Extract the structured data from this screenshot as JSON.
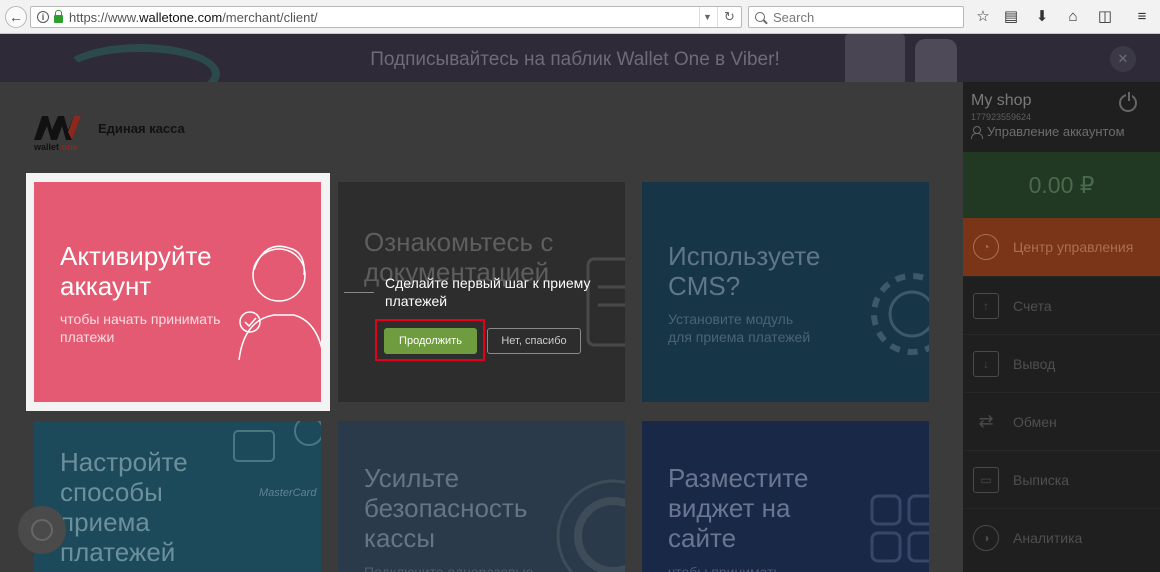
{
  "browser": {
    "url_prefix": "https://www.",
    "url_domain": "walletone.com",
    "url_path": "/merchant/client/",
    "search_placeholder": "Search"
  },
  "banner": {
    "text": "Подписывайтесь на паблик Wallet One в Viber!",
    "close": "✕"
  },
  "header": {
    "logo_sub_a": "wallet ",
    "logo_sub_b": "one",
    "title": "Единая касса"
  },
  "tiles": {
    "activate": {
      "title_1": "Активируйте",
      "title_2": "аккаунт",
      "sub_1": "чтобы начать принимать",
      "sub_2": "платежи"
    },
    "docs": {
      "title_1": "Ознакомьтесь с",
      "title_2": "документацией"
    },
    "cms": {
      "title_1": "Используете",
      "title_2": "CMS?",
      "sub_1": "Установите модуль",
      "sub_2": "для приема платежей"
    },
    "payment_methods": {
      "title_1": "Настройте",
      "title_2": "способы",
      "title_3": "приема",
      "title_4": "платежей"
    },
    "security": {
      "title_1": "Усильте",
      "title_2": "безопасность",
      "title_3": "кассы",
      "sub_1": "Подключите одноразовые"
    },
    "widget": {
      "title_1": "Разместите",
      "title_2": "виджет на",
      "title_3": "сайте",
      "sub_1": "чтобы принимать"
    }
  },
  "popup": {
    "text": "Сделайте первый шаг к приему платежей",
    "continue_label": "Продолжить",
    "no_label": "Нет, спасибо"
  },
  "sidebar": {
    "shop_name": "My shop",
    "shop_id": "177923559624",
    "account_label": "Управление аккаунтом",
    "balance": "0.00 ₽",
    "items": [
      {
        "label": "Центр управления",
        "icon": "gauge-icon",
        "active": true
      },
      {
        "label": "Счета",
        "icon": "invoice-icon"
      },
      {
        "label": "Вывод",
        "icon": "withdraw-icon"
      },
      {
        "label": "Обмен",
        "icon": "exchange-icon"
      },
      {
        "label": "Выписка",
        "icon": "statement-icon"
      },
      {
        "label": "Аналитика",
        "icon": "analytics-icon"
      }
    ]
  },
  "colors": {
    "accent_pink": "#e35a72",
    "continue_green": "#6e9c3e",
    "highlight_red": "#e2001a",
    "active_menu": "#7a3518"
  }
}
